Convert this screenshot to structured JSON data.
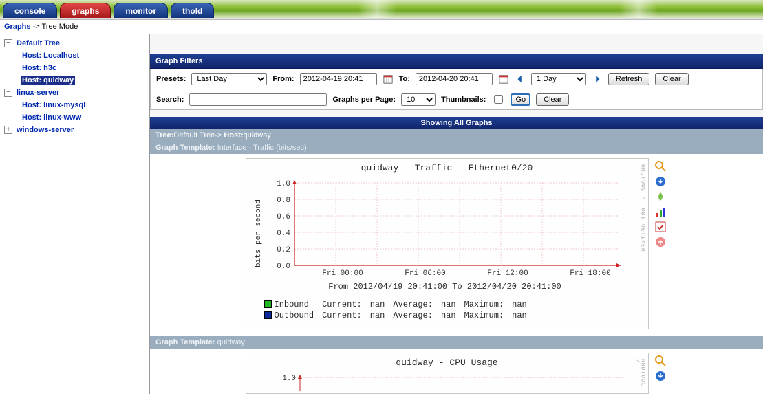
{
  "tabs": {
    "console": "console",
    "graphs": "graphs",
    "monitor": "monitor",
    "thold": "thold"
  },
  "breadcrumb": {
    "root": "Graphs",
    "arrow": " -> ",
    "leaf": "Tree Mode"
  },
  "tree": {
    "default": "Default Tree",
    "host_local": "Host: Localhost",
    "host_h3c": "Host: h3c",
    "host_quidway": "Host: quidway",
    "linux_server": "linux-server",
    "host_linux_mysql": "Host: linux-mysql",
    "host_linux_www": "Host: linux-www",
    "windows_server": "windows-server"
  },
  "filters": {
    "title": "Graph Filters",
    "presets_label": "Presets:",
    "presets_value": "Last Day",
    "from_label": "From:",
    "from_value": "2012-04-19 20:41",
    "to_label": "To:",
    "to_value": "2012-04-20 20:41",
    "span_value": "1 Day",
    "refresh": "Refresh",
    "clear": "Clear",
    "search_label": "Search:",
    "search_value": "",
    "gpp_label": "Graphs per Page:",
    "gpp_value": "10",
    "thumb_label": "Thumbnails:",
    "go": "Go"
  },
  "showing": "Showing All Graphs",
  "crumb": {
    "tree_lbl": "Tree:",
    "tree_val": "Default Tree",
    "sep": "-> ",
    "host_lbl": "Host:",
    "host_val": "quidway"
  },
  "template1": {
    "lbl": "Graph Template: ",
    "val": "Interface - Traffic (bits/sec)"
  },
  "template2": {
    "lbl": "Graph Template: ",
    "val": "quidway"
  },
  "graph1": {
    "title": "quidway - Traffic - Ethernet0/20",
    "ylabel": "bits per second",
    "subtitle": "From 2012/04/19 20:41:00 To 2012/04/20 20:41:00",
    "yticks": [
      "1.0",
      "0.8",
      "0.6",
      "0.4",
      "0.2",
      "0.0"
    ],
    "xticks": [
      "Fri 00:00",
      "Fri 06:00",
      "Fri 12:00",
      "Fri 18:00"
    ],
    "legend": [
      {
        "name": "Inbound",
        "color": "#22b522",
        "cur_l": "Current:",
        "cur": "nan",
        "avg_l": "Average:",
        "avg": "nan",
        "max_l": "Maximum:",
        "max": "nan"
      },
      {
        "name": "Outbound",
        "color": "#0a2a9a",
        "cur_l": "Current:",
        "cur": "nan",
        "avg_l": "Average:",
        "avg": "nan",
        "max_l": "Maximum:",
        "max": "nan"
      }
    ]
  },
  "graph2": {
    "title": "quidway - CPU Usage",
    "ytick": "1.0"
  },
  "sidetext": "RRDTOOL / TOBI OETIKER",
  "chart_data": [
    {
      "type": "line",
      "title": "quidway - Traffic - Ethernet0/20",
      "ylabel": "bits per second",
      "ylim": [
        0.0,
        1.0
      ],
      "x_range": [
        "2012-04-19 20:41",
        "2012-04-20 20:41"
      ],
      "xticks": [
        "Fri 00:00",
        "Fri 06:00",
        "Fri 12:00",
        "Fri 18:00"
      ],
      "series": [
        {
          "name": "Inbound",
          "color": "#22b522",
          "values": null,
          "current": "nan",
          "average": "nan",
          "maximum": "nan"
        },
        {
          "name": "Outbound",
          "color": "#0a2a9a",
          "values": null,
          "current": "nan",
          "average": "nan",
          "maximum": "nan"
        }
      ]
    },
    {
      "type": "line",
      "title": "quidway - CPU Usage",
      "ylim": [
        0.0,
        1.0
      ],
      "x_range": [
        "2012-04-19 20:41",
        "2012-04-20 20:41"
      ],
      "series": []
    }
  ]
}
